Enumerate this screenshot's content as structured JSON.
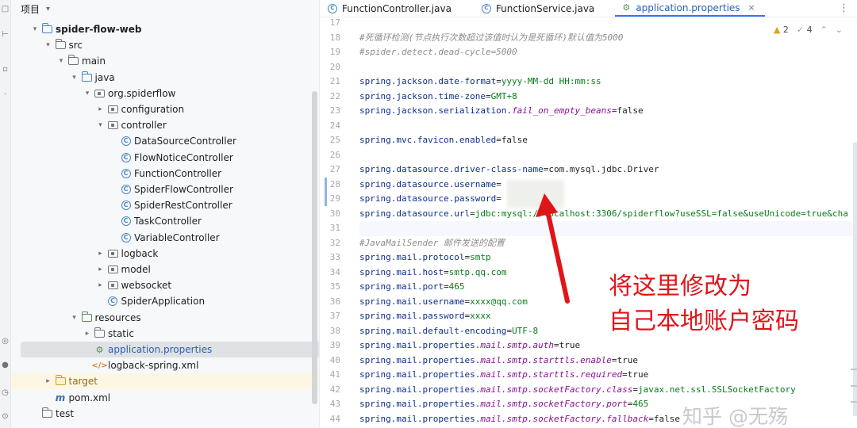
{
  "project": {
    "title": "项目",
    "tree": [
      {
        "label": "spider-flow-web",
        "depth": 0,
        "arrow": "down",
        "icon": "module",
        "style": "module"
      },
      {
        "label": "src",
        "depth": 1,
        "arrow": "down",
        "icon": "folder"
      },
      {
        "label": "main",
        "depth": 2,
        "arrow": "down",
        "icon": "folder"
      },
      {
        "label": "java",
        "depth": 3,
        "arrow": "down",
        "icon": "folder-src"
      },
      {
        "label": "org.spiderflow",
        "depth": 4,
        "arrow": "down",
        "icon": "package"
      },
      {
        "label": "configuration",
        "depth": 5,
        "arrow": "right",
        "icon": "package"
      },
      {
        "label": "controller",
        "depth": 5,
        "arrow": "down",
        "icon": "package"
      },
      {
        "label": "DataSourceController",
        "depth": 6,
        "arrow": "",
        "icon": "class"
      },
      {
        "label": "FlowNoticeController",
        "depth": 6,
        "arrow": "",
        "icon": "class"
      },
      {
        "label": "FunctionController",
        "depth": 6,
        "arrow": "",
        "icon": "class"
      },
      {
        "label": "SpiderFlowController",
        "depth": 6,
        "arrow": "",
        "icon": "class"
      },
      {
        "label": "SpiderRestController",
        "depth": 6,
        "arrow": "",
        "icon": "class"
      },
      {
        "label": "TaskController",
        "depth": 6,
        "arrow": "",
        "icon": "class"
      },
      {
        "label": "VariableController",
        "depth": 6,
        "arrow": "",
        "icon": "class"
      },
      {
        "label": "logback",
        "depth": 5,
        "arrow": "right",
        "icon": "package"
      },
      {
        "label": "model",
        "depth": 5,
        "arrow": "right",
        "icon": "package"
      },
      {
        "label": "websocket",
        "depth": 5,
        "arrow": "right",
        "icon": "package"
      },
      {
        "label": "SpiderApplication",
        "depth": 5,
        "arrow": "",
        "icon": "class"
      },
      {
        "label": "resources",
        "depth": 3,
        "arrow": "down",
        "icon": "folder-res"
      },
      {
        "label": "static",
        "depth": 4,
        "arrow": "right",
        "icon": "folder"
      },
      {
        "label": "application.properties",
        "depth": 4,
        "arrow": "",
        "icon": "properties",
        "style": "link",
        "selected": true
      },
      {
        "label": "logback-spring.xml",
        "depth": 4,
        "arrow": "",
        "icon": "xml"
      },
      {
        "label": "target",
        "depth": 1,
        "arrow": "right",
        "icon": "folder-target",
        "style": "target",
        "excluded": true
      },
      {
        "label": "pom.xml",
        "depth": 1,
        "arrow": "",
        "icon": "maven"
      },
      {
        "label": "test",
        "depth": 0,
        "arrow": "",
        "icon": "folder"
      }
    ]
  },
  "editor": {
    "tabs": [
      {
        "label": "FunctionController.java",
        "icon": "class",
        "active": false
      },
      {
        "label": "FunctionService.java",
        "icon": "class",
        "active": false
      },
      {
        "label": "application.properties",
        "icon": "properties",
        "active": true
      }
    ],
    "inspections": {
      "warnings": "2",
      "weak_warnings": "4"
    },
    "caret_line": 31,
    "changed_lines": [
      28,
      29
    ],
    "lines": [
      {
        "n": "17",
        "parts": []
      },
      {
        "n": "18",
        "parts": [
          [
            "cm",
            "#死循环检测(节点执行次数超过该值时认为是死循环)默认值为5000"
          ]
        ]
      },
      {
        "n": "19",
        "parts": [
          [
            "cm",
            "#spider.detect.dead-cycle=5000"
          ]
        ]
      },
      {
        "n": "20",
        "parts": []
      },
      {
        "n": "21",
        "parts": [
          [
            "k",
            "spring.jackson.date-format"
          ],
          [
            "eq",
            "="
          ],
          [
            "v",
            "yyyy-MM-dd HH:mm:ss"
          ]
        ]
      },
      {
        "n": "22",
        "parts": [
          [
            "k",
            "spring.jackson.time-zone"
          ],
          [
            "eq",
            "="
          ],
          [
            "v",
            "GMT+8"
          ]
        ]
      },
      {
        "n": "23",
        "parts": [
          [
            "k",
            "spring.jackson.serialization."
          ],
          [
            "it",
            "fail_on_empty_beans"
          ],
          [
            "eq",
            "="
          ],
          [
            "vb",
            "false"
          ]
        ]
      },
      {
        "n": "24",
        "parts": []
      },
      {
        "n": "25",
        "parts": [
          [
            "k",
            "spring.mvc.favicon.enabled"
          ],
          [
            "eq",
            "="
          ],
          [
            "vb",
            "false"
          ]
        ]
      },
      {
        "n": "26",
        "parts": []
      },
      {
        "n": "27",
        "parts": [
          [
            "k",
            "spring.datasource.driver-class-name"
          ],
          [
            "eq",
            "="
          ],
          [
            "vb",
            "com.mysql.jdbc.Driver"
          ]
        ]
      },
      {
        "n": "28",
        "parts": [
          [
            "k",
            "spring.datasource.username"
          ],
          [
            "eq",
            "="
          ]
        ]
      },
      {
        "n": "29",
        "parts": [
          [
            "k",
            "spring.datasource.password"
          ],
          [
            "eq",
            "="
          ]
        ]
      },
      {
        "n": "30",
        "parts": [
          [
            "k",
            "spring.datasource.url"
          ],
          [
            "eq",
            "="
          ],
          [
            "v",
            "jdbc:mysql://localhost:3306/spiderflow?useSSL=false&useUnicode=true&cha"
          ]
        ]
      },
      {
        "n": "31",
        "parts": []
      },
      {
        "n": "32",
        "parts": [
          [
            "cm",
            "#JavaMailSender 邮件发送的配置"
          ]
        ]
      },
      {
        "n": "33",
        "parts": [
          [
            "k",
            "spring.mail.protocol"
          ],
          [
            "eq",
            "="
          ],
          [
            "v",
            "smtp"
          ]
        ]
      },
      {
        "n": "34",
        "parts": [
          [
            "k",
            "spring.mail.host"
          ],
          [
            "eq",
            "="
          ],
          [
            "v",
            "smtp.qq.com"
          ]
        ]
      },
      {
        "n": "35",
        "parts": [
          [
            "k",
            "spring.mail.port"
          ],
          [
            "eq",
            "="
          ],
          [
            "v",
            "465"
          ]
        ]
      },
      {
        "n": "36",
        "parts": [
          [
            "k",
            "spring.mail.username"
          ],
          [
            "eq",
            "="
          ],
          [
            "v",
            "xxxx@qq.com"
          ]
        ]
      },
      {
        "n": "37",
        "parts": [
          [
            "k",
            "spring.mail.password"
          ],
          [
            "eq",
            "="
          ],
          [
            "v",
            "xxxx"
          ]
        ]
      },
      {
        "n": "38",
        "parts": [
          [
            "k",
            "spring.mail.default-encoding"
          ],
          [
            "eq",
            "="
          ],
          [
            "v",
            "UTF-8"
          ]
        ]
      },
      {
        "n": "39",
        "parts": [
          [
            "k",
            "spring.mail.properties."
          ],
          [
            "it",
            "mail.smtp.auth"
          ],
          [
            "eq",
            "="
          ],
          [
            "vb",
            "true"
          ]
        ]
      },
      {
        "n": "40",
        "parts": [
          [
            "k",
            "spring.mail.properties."
          ],
          [
            "it",
            "mail.smtp.starttls.enable"
          ],
          [
            "eq",
            "="
          ],
          [
            "vb",
            "true"
          ]
        ]
      },
      {
        "n": "41",
        "parts": [
          [
            "k",
            "spring.mail.properties."
          ],
          [
            "it",
            "mail.smtp.starttls.required"
          ],
          [
            "eq",
            "="
          ],
          [
            "vb",
            "true"
          ]
        ]
      },
      {
        "n": "42",
        "parts": [
          [
            "k",
            "spring.mail.properties."
          ],
          [
            "it",
            "mail.smtp.socketFactory.class"
          ],
          [
            "eq",
            "="
          ],
          [
            "v",
            "javax.net.ssl.SSLSocketFactory"
          ]
        ]
      },
      {
        "n": "43",
        "parts": [
          [
            "k",
            "spring.mail.properties."
          ],
          [
            "it",
            "mail.smtp.socketFactory.port"
          ],
          [
            "eq",
            "="
          ],
          [
            "v",
            "465"
          ]
        ]
      },
      {
        "n": "44",
        "parts": [
          [
            "k",
            "spring.mail.properties."
          ],
          [
            "it",
            "mail.smtp.socketFactory.fallback"
          ],
          [
            "eq",
            "="
          ],
          [
            "vb",
            "false"
          ]
        ]
      }
    ]
  },
  "annotation": {
    "text_line1": "将这里修改为",
    "text_line2": "自己本地账户密码",
    "color": "#e0151a"
  },
  "watermark": "知乎 @无殇",
  "icons": {
    "expanded": "▾",
    "collapsed": "▸",
    "close": "×",
    "more": "⋮",
    "warning": "▲",
    "weak_warning": "✓",
    "class": "C",
    "properties": "⚙",
    "xml": "</>",
    "maven": "m"
  }
}
